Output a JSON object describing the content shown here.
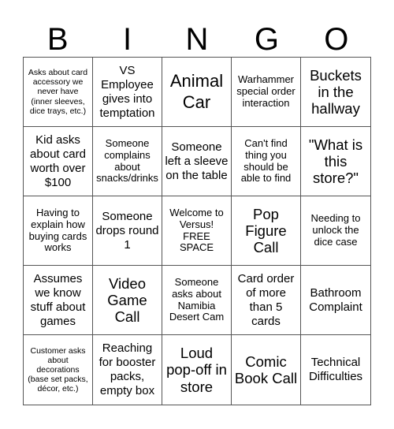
{
  "header": {
    "letters": [
      "B",
      "I",
      "N",
      "G",
      "O"
    ]
  },
  "board": {
    "cells": [
      "Asks about card accessory we never have (inner sleeves, dice trays, etc.)",
      "VS Employee gives into temptation",
      "Animal Car",
      "Warhammer special order interaction",
      "Buckets in the hallway",
      "Kid asks about card worth over $100",
      "Someone complains about snacks/drinks",
      "Someone left a sleeve on the table",
      "Can't find thing you should be able to find",
      "\"What is this store?\"",
      "Having to explain how buying cards works",
      "Someone drops round 1",
      "Welcome to Versus! FREE SPACE",
      "Pop Figure Call",
      "Needing to unlock the dice case",
      "Assumes we know stuff about games",
      "Video Game Call",
      "Someone asks about Namibia Desert Cam",
      "Card order of more than 5 cards",
      "Bathroom Complaint",
      "Customer asks about decorations (base set packs, décor, etc.)",
      "Reaching for booster packs, empty box",
      "Loud pop-off in store",
      "Comic Book Call",
      "Technical Difficulties"
    ]
  }
}
